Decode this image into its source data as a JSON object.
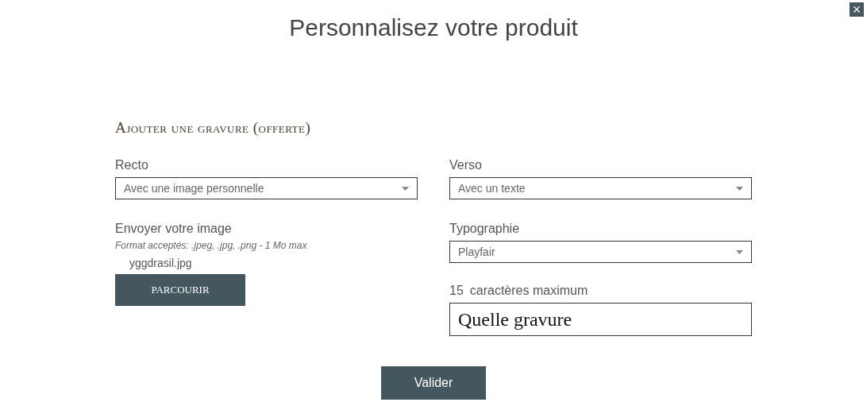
{
  "title": "Personnalisez votre produit",
  "close": {
    "label": "×"
  },
  "section_title": "Ajouter une gravure (offerte)",
  "recto": {
    "label": "Recto",
    "select": {
      "value": "Avec une image personnelle"
    }
  },
  "verso": {
    "label": "Verso",
    "select": {
      "value": "Avec un texte"
    }
  },
  "upload": {
    "label": "Envoyer votre image",
    "hint": "Format acceptés: .jpeg, .jpg, .png - 1 Mo max",
    "filename": "yggdrasil.jpg",
    "button": "PARCOURIR"
  },
  "typography": {
    "label": "Typographie",
    "select": {
      "value": "Playfair"
    }
  },
  "engraving": {
    "count": "15",
    "label": "caractères maximum",
    "value": "Quelle gravure"
  },
  "submit": "Valider"
}
